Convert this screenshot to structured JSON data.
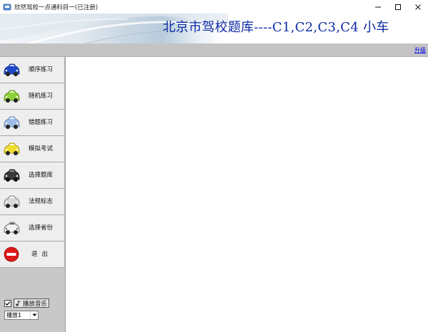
{
  "window": {
    "title": "欣然驾校一点通科目一(已注册)"
  },
  "banner": {
    "title": "北京市驾校题库----C1,C2,C3,C4 小车"
  },
  "toolbar": {
    "upgrade_label": "升级"
  },
  "sidebar": {
    "items": [
      {
        "label": "顺序练习",
        "icon": "car-icon",
        "color": "#2148c8"
      },
      {
        "label": "随机练习",
        "icon": "car-icon",
        "color": "#8fd13a"
      },
      {
        "label": "错题练习",
        "icon": "car-icon",
        "color": "#9fbde6"
      },
      {
        "label": "模拟考试",
        "icon": "car-icon",
        "color": "#f0dc2c"
      },
      {
        "label": "选择题库",
        "icon": "car-icon",
        "color": "#3a3a3a"
      },
      {
        "label": "法规标志",
        "icon": "car-icon",
        "color": "#d8d8d8"
      },
      {
        "label": "选择省份",
        "icon": "car-icon",
        "color": "#f2f2f2"
      },
      {
        "label": "退出",
        "icon": "no-entry-icon",
        "color": "#e01818"
      }
    ],
    "music": {
      "checked": true,
      "label": "播放音乐",
      "selected": "播放1"
    }
  }
}
